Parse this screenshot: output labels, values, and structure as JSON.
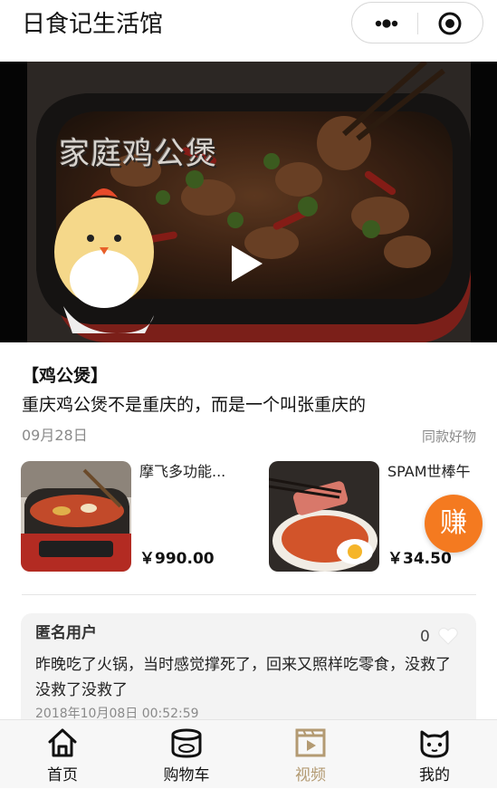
{
  "app_title": "日食记生活馆",
  "video": {
    "caption": "家庭鸡公煲"
  },
  "article": {
    "tag_title": "【鸡公煲】",
    "headline": "重庆鸡公煲不是重庆的，而是一个叫张重庆的",
    "date": "09月28日",
    "same_goods_link": "同款好物"
  },
  "products": [
    {
      "name": "摩飞多功能...",
      "price": "￥990.00"
    },
    {
      "name": "SPAM世棒午",
      "price": "￥34.50"
    }
  ],
  "earn_button_label": "赚",
  "comment": {
    "user": "匿名用户",
    "likes": "0",
    "text": "昨晚吃了火锅，当时感觉撑死了，回来又照样吃零食，没救了没救了没救了",
    "time": "2018年10月08日 00:52:59"
  },
  "tabbar": {
    "items": [
      {
        "label": "首页",
        "icon": "home-icon"
      },
      {
        "label": "购物车",
        "icon": "cart-icon"
      },
      {
        "label": "视频",
        "icon": "video-icon"
      },
      {
        "label": "我的",
        "icon": "cat-icon"
      }
    ],
    "active_index": 2
  },
  "colors": {
    "accent": "#b39a72",
    "earn_button": "#f47a20"
  }
}
